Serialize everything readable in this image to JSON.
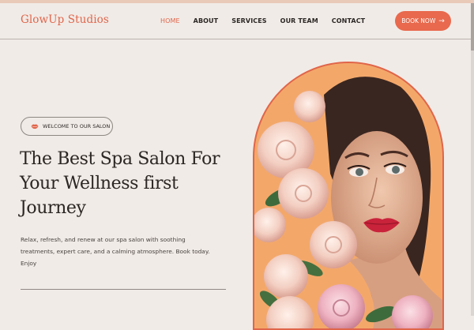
{
  "header": {
    "logo": "GlowUp Studios",
    "nav": [
      "HOME",
      "ABOUT",
      "SERVICES",
      "OUR TEAM",
      "CONTACT"
    ],
    "active_nav": "HOME",
    "book_button": "BOOK NOW",
    "book_arrow": "→"
  },
  "hero": {
    "badge": "WELCOME TO OUR SALON",
    "title_lines": [
      "The Best Spa Salon For",
      "Your Wellness first",
      "Journey"
    ],
    "description": "Relax, refresh, and renew at our spa salon with soothing treatments, expert care, and a calming atmosphere. Book today. Enjoy"
  },
  "colors": {
    "accent": "#e8694d",
    "background": "#f1ebe7",
    "hero_bg": "#f3a86a"
  }
}
